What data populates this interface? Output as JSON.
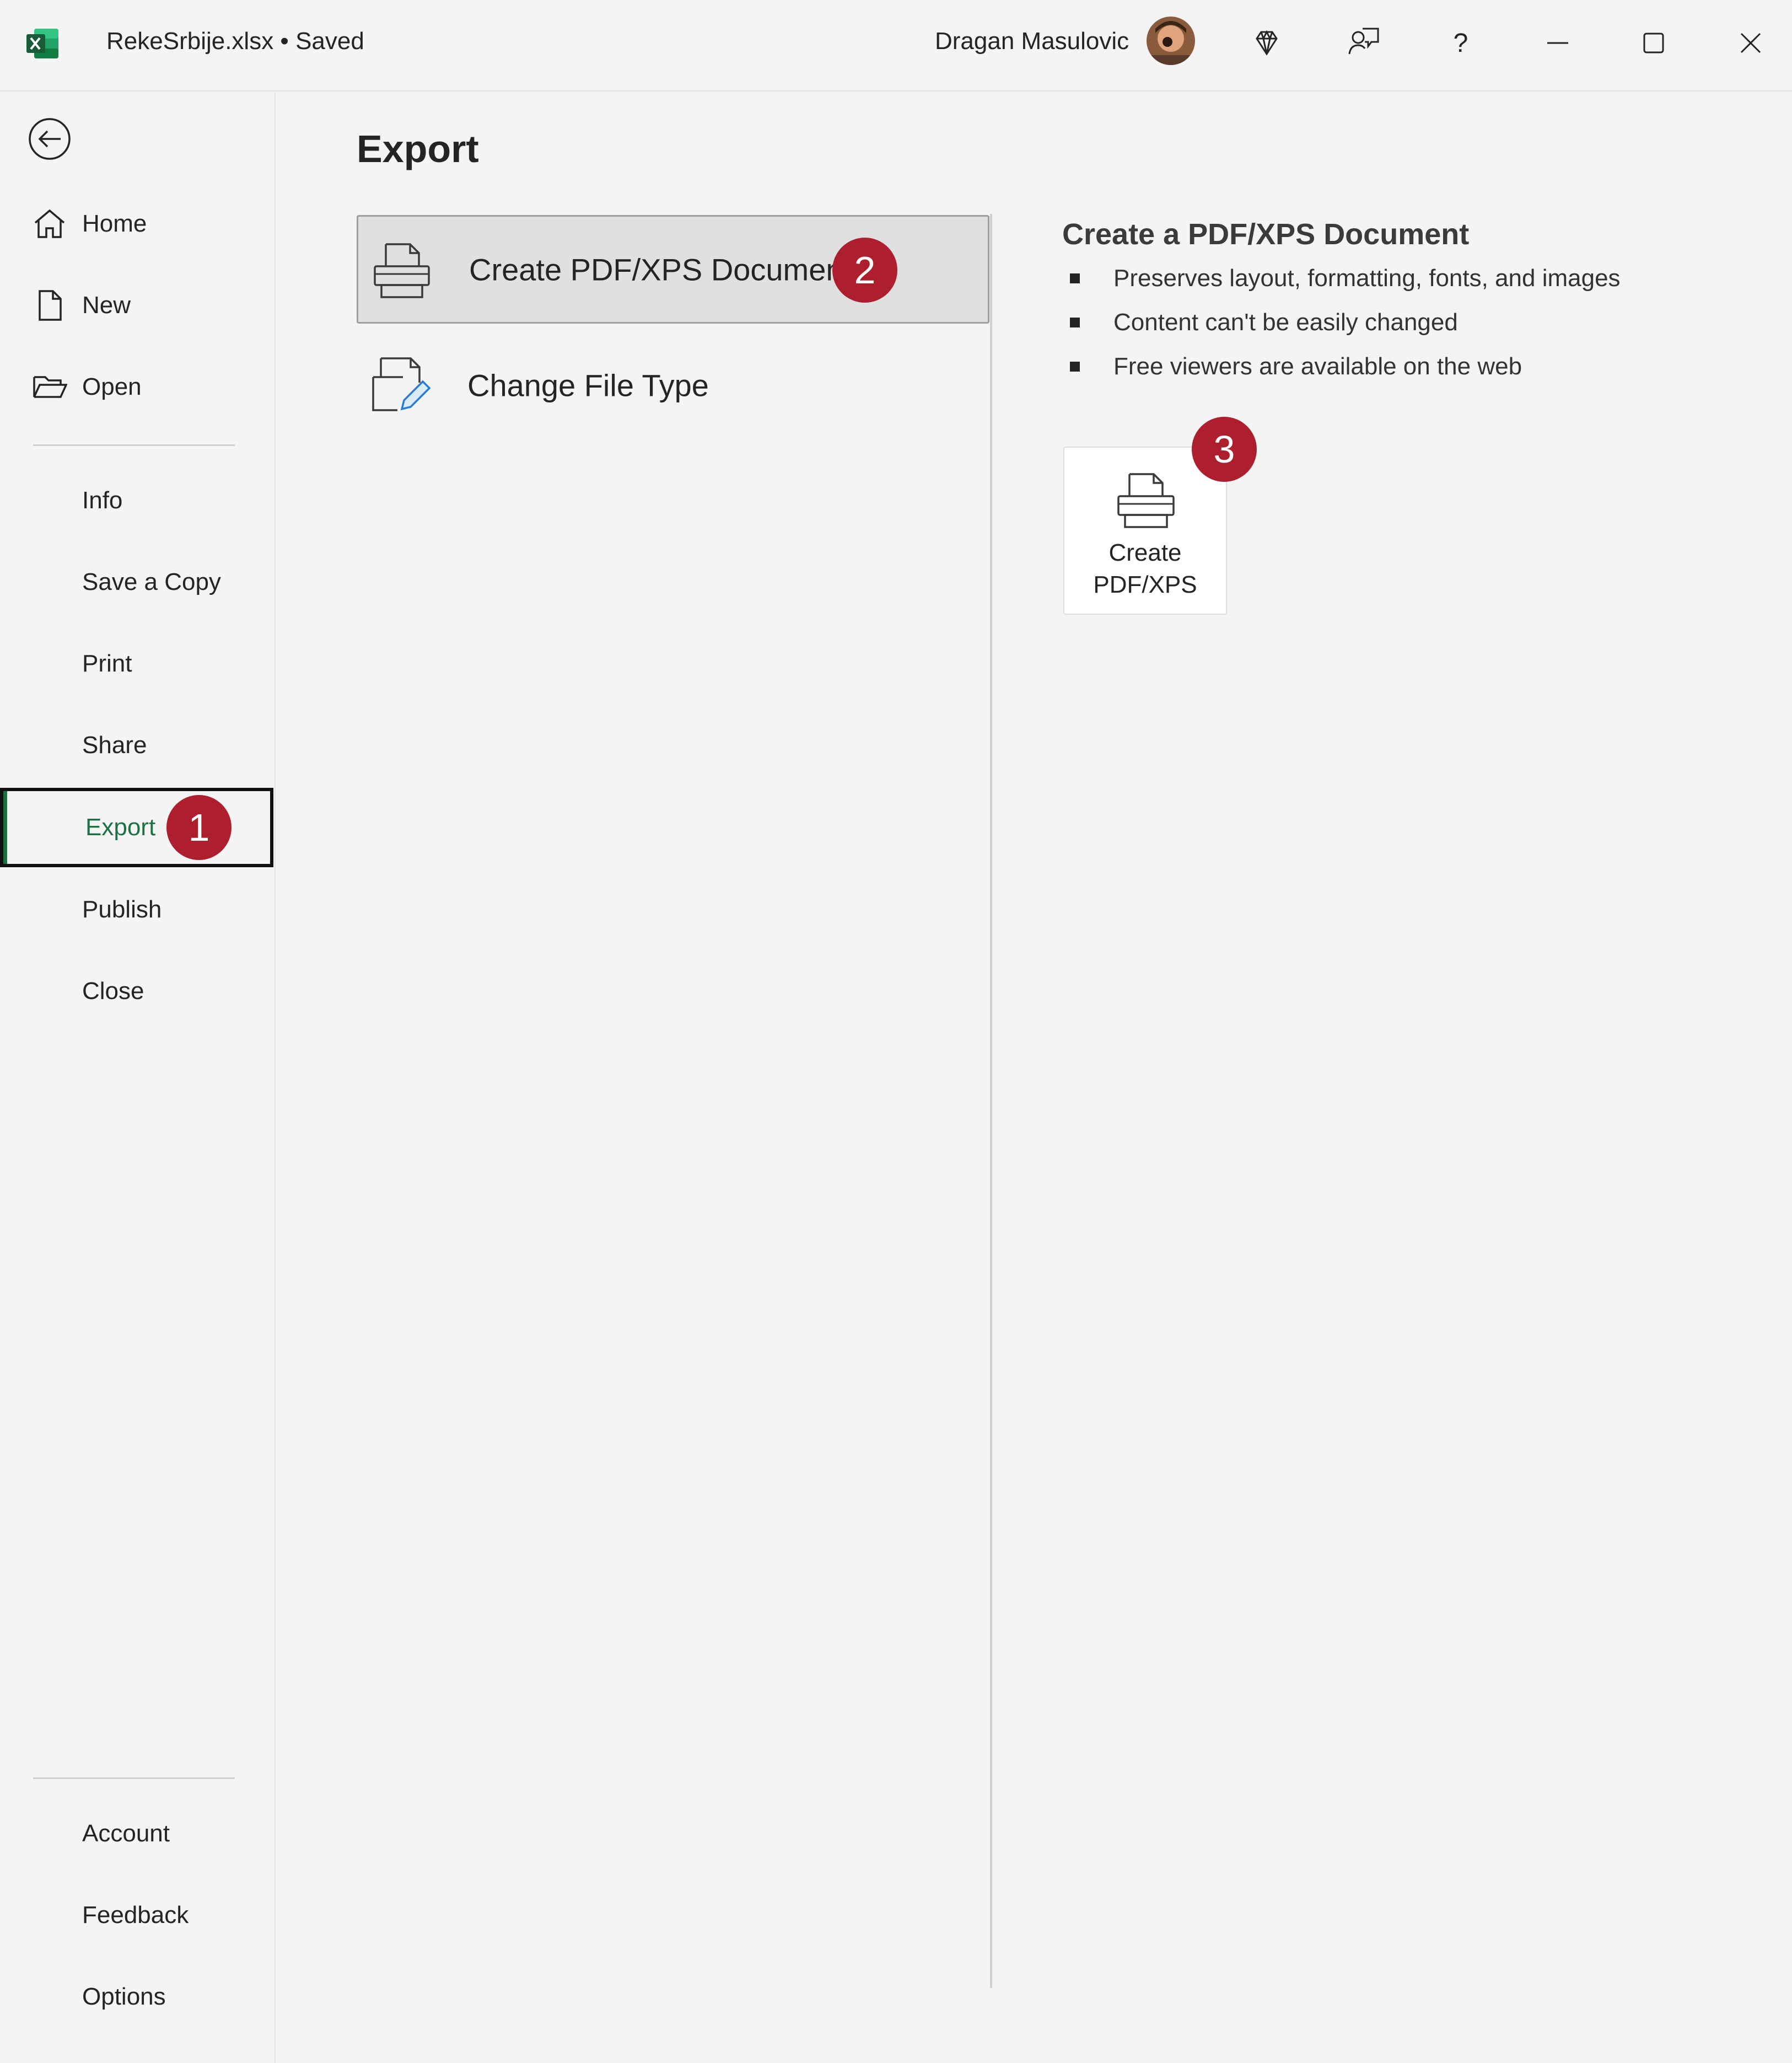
{
  "window": {
    "title": "RekeSrbije.xlsx • Saved",
    "user_name": "Dragan Masulovic",
    "icons": [
      "excel-logo",
      "premium-diamond-icon",
      "coauthor-icon",
      "help-icon",
      "minimize-icon",
      "maximize-icon",
      "close-icon"
    ],
    "help_glyph": "?"
  },
  "sidebar": {
    "top_items": [
      {
        "label": "Home",
        "icon": "home-icon"
      },
      {
        "label": "New",
        "icon": "new-document-icon"
      },
      {
        "label": "Open",
        "icon": "folder-open-icon"
      }
    ],
    "middle_items": [
      {
        "label": "Info"
      },
      {
        "label": "Save a Copy"
      },
      {
        "label": "Print"
      },
      {
        "label": "Share"
      },
      {
        "label": "Export",
        "selected": true
      },
      {
        "label": "Publish"
      },
      {
        "label": "Close"
      }
    ],
    "bottom_items": [
      {
        "label": "Account"
      },
      {
        "label": "Feedback"
      },
      {
        "label": "Options"
      }
    ],
    "accent_color": "#1e7145"
  },
  "main": {
    "title": "Export",
    "options": [
      {
        "label": "Create PDF/XPS Document",
        "selected": true
      },
      {
        "label": "Change File Type",
        "selected": false
      }
    ],
    "detail": {
      "title": "Create a PDF/XPS Document",
      "bullets": [
        "Preserves layout, formatting, fonts, and images",
        "Content can't be easily changed",
        "Free viewers are available on the web"
      ],
      "button_line1": "Create",
      "button_line2": "PDF/XPS"
    }
  },
  "callouts": {
    "step1": "1",
    "step2": "2",
    "step3": "3",
    "color": "#ad1f2f"
  }
}
